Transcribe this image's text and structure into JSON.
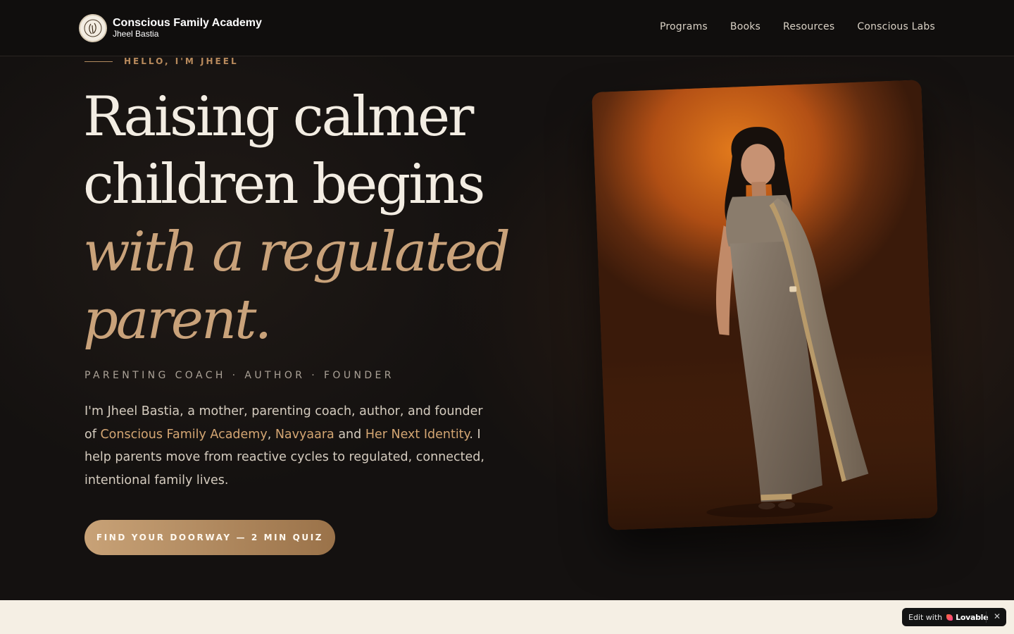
{
  "header": {
    "brand_title": "Conscious Family Academy",
    "brand_subtitle": "Jheel Bastia",
    "nav": [
      {
        "label": "Programs"
      },
      {
        "label": "Books"
      },
      {
        "label": "Resources"
      },
      {
        "label": "Conscious Labs"
      }
    ]
  },
  "hero": {
    "eyebrow": "HELLO, I'M JHEEL",
    "headline_line1": "Raising calmer",
    "headline_line2": "children begins",
    "headline_accent_line1": "with a regulated",
    "headline_accent_line2": "parent.",
    "roles": "PARENTING COACH · AUTHOR · FOUNDER",
    "bio": {
      "part1": "I'm Jheel Bastia, a mother, parenting coach, author, and founder of ",
      "link1": "Conscious Family Academy",
      "sep1": ", ",
      "link2": "Navyaara",
      "sep2": " and ",
      "link3": "Her Next Identity",
      "part2": ". I help parents move from reactive cycles to regulated, connected, intentional family lives."
    },
    "cta_label": "FIND YOUR DOORWAY — 2 MIN QUIZ"
  },
  "badge": {
    "prefix": "Edit with",
    "brand": "Lovable",
    "close": "✕"
  },
  "colors": {
    "accent_gold": "#c9a27a",
    "link_gold": "#d4a673",
    "background_dark": "#141110",
    "cream": "#f5efe4"
  }
}
